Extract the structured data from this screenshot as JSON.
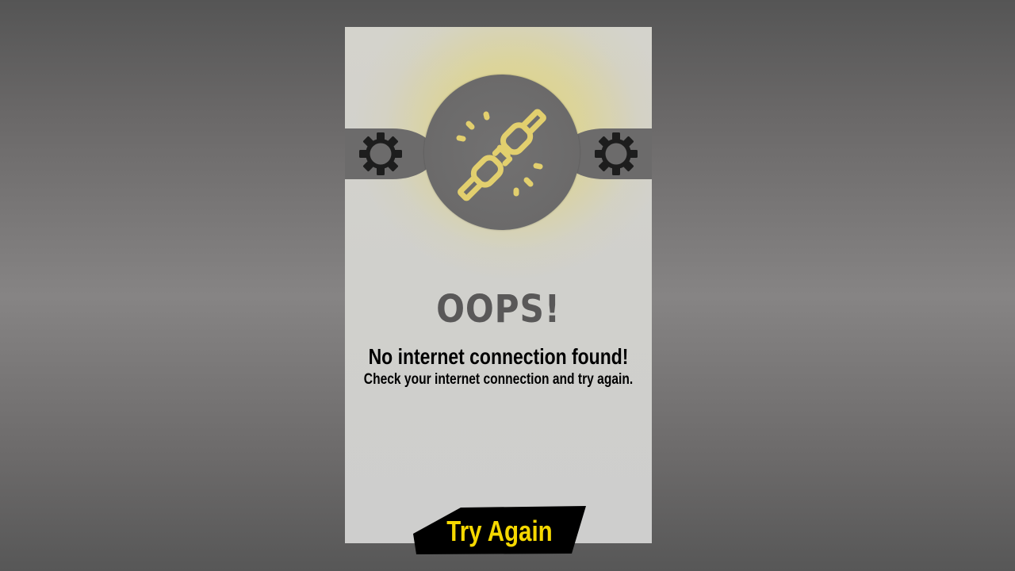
{
  "screen": {
    "headline": "OOPS!",
    "title": "No internet connection found!",
    "subtitle": "Check your internet connection and try again."
  },
  "button": {
    "label": "Try Again"
  },
  "icons": {
    "main": "unplugged-plug-icon",
    "left": "gear-icon",
    "right": "gear-icon"
  },
  "colors": {
    "accent": "#f5d800",
    "icon": "#e2cf6e",
    "headline": "#595858",
    "button_bg": "#000000",
    "glow": "#e2d678"
  }
}
